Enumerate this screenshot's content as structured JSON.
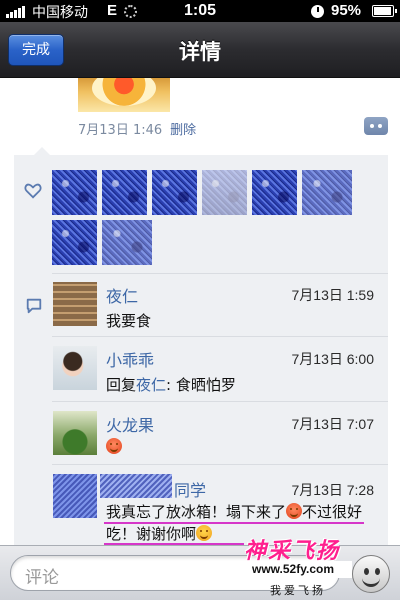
{
  "status_bar": {
    "carrier": "中国移动",
    "network": "E",
    "time": "1:05",
    "battery": "95%"
  },
  "nav": {
    "done_label": "完成",
    "title": "详情"
  },
  "post": {
    "date": "7月13日 1:46",
    "delete_label": "删除"
  },
  "comments": [
    {
      "name": "夜仁",
      "time": "7月13日 1:59",
      "text": "我要食"
    },
    {
      "name": "小乖乖",
      "time": "7月13日 6:00",
      "reply_prefix": "回复",
      "reply_to": "夜仁",
      "text": ": 食晒怕罗"
    },
    {
      "name": "火龙果",
      "time": "7月13日 7:07",
      "text": ""
    },
    {
      "name": "同学",
      "time": "7月13日 7:28",
      "text_part1": "我真忘了放冰箱！塌下来了",
      "text_part2": "不过很好吃！谢谢你啊"
    }
  ],
  "input": {
    "placeholder": "评论"
  },
  "watermark": {
    "main": "神采飞扬",
    "url": "www.52fy.com",
    "sub": "我爱飞扬"
  },
  "colors": {
    "accent_blue": "#3d67a6",
    "highlight_magenta": "#d636c9",
    "nav_dark": "#2c2c30"
  }
}
